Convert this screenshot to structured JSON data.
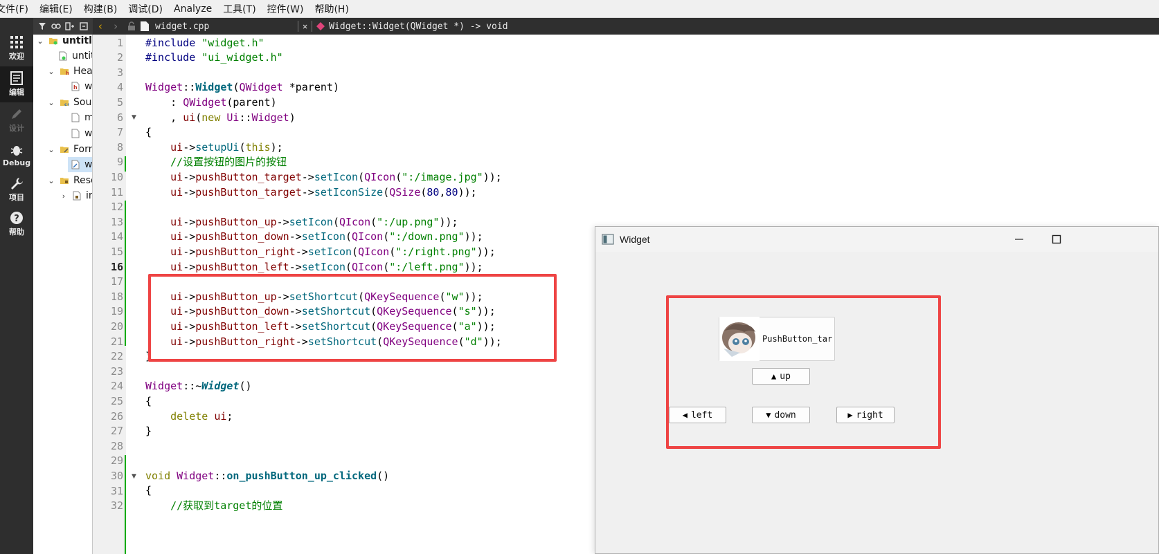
{
  "menubar": {
    "items": [
      "文件(F)",
      "编辑(E)",
      "构建(B)",
      "调试(D)",
      "Analyze",
      "工具(T)",
      "控件(W)",
      "帮助(H)"
    ]
  },
  "modebar": {
    "modes": [
      {
        "label": "欢迎",
        "icon": "grid-icon",
        "state": "normal"
      },
      {
        "label": "编辑",
        "icon": "document-icon",
        "state": "active"
      },
      {
        "label": "设计",
        "icon": "pencil-icon",
        "state": "disabled"
      },
      {
        "label": "Debug",
        "icon": "bug-icon",
        "state": "normal"
      },
      {
        "label": "项目",
        "icon": "wrench-icon",
        "state": "normal"
      },
      {
        "label": "帮助",
        "icon": "help-icon",
        "state": "normal"
      }
    ]
  },
  "project_tree": {
    "items": [
      {
        "label": "untitle",
        "bold": true
      },
      {
        "label": "untit"
      },
      {
        "label": "Head"
      },
      {
        "label": "w"
      },
      {
        "label": "Sour"
      },
      {
        "label": "m"
      },
      {
        "label": "w"
      },
      {
        "label": "Forn"
      },
      {
        "label": "w"
      },
      {
        "label": "Reso"
      },
      {
        "label": "im"
      }
    ]
  },
  "editor_tab": {
    "file_name": "widget.cpp",
    "close_glyph": "✕",
    "symbol": "Widget::Widget(QWidget *) -> void"
  },
  "code": {
    "line_numbers": [
      "1",
      "2",
      "3",
      "4",
      "5",
      "6",
      "7",
      "8",
      "9",
      "10",
      "11",
      "12",
      "13",
      "14",
      "15",
      "16",
      "17",
      "18",
      "19",
      "20",
      "21",
      "22",
      "23",
      "24",
      "25",
      "26",
      "27",
      "28",
      "29",
      "30",
      "31",
      "32"
    ],
    "current_line": "16"
  },
  "widget_window": {
    "title": "Widget",
    "target_button_label": "PushButton_tar",
    "up_label": "up",
    "down_label": "down",
    "left_label": "left",
    "right_label": "right"
  },
  "colors": {
    "highlight_red": "#ee4444",
    "change_green": "#00aa00",
    "mode_bar_bg": "#2e2e2e"
  }
}
